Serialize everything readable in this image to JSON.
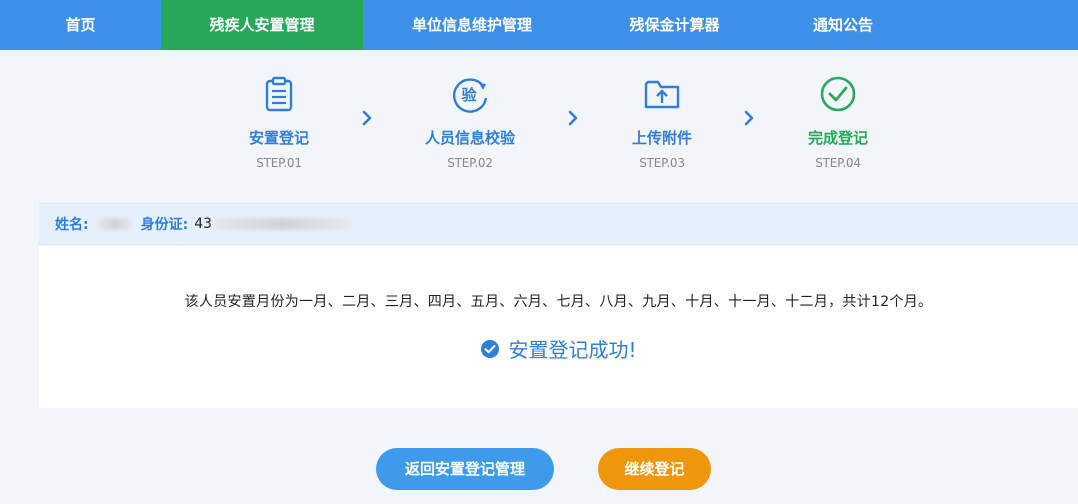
{
  "nav": {
    "items": [
      {
        "label": "首页",
        "active": false
      },
      {
        "label": "残疾人安置管理",
        "active": true
      },
      {
        "label": "单位信息维护管理",
        "active": false
      },
      {
        "label": "残保金计算器",
        "active": false
      },
      {
        "label": "通知公告",
        "active": false
      }
    ]
  },
  "steps": [
    {
      "title": "安置登记",
      "sub": "STEP.01",
      "icon": "clipboard-icon"
    },
    {
      "title": "人员信息校验",
      "sub": "STEP.02",
      "icon": "verify-icon",
      "glyph": "验"
    },
    {
      "title": "上传附件",
      "sub": "STEP.03",
      "icon": "upload-folder-icon"
    },
    {
      "title": "完成登记",
      "sub": "STEP.04",
      "icon": "check-circle-icon"
    }
  ],
  "info": {
    "name_label": "姓名:",
    "id_label": "身份证:",
    "id_value_visible": "43"
  },
  "result": {
    "months_text": "该人员安置月份为一月、二月、三月、四月、五月、六月、七月、八月、九月、十月、十一月、十二月，共计12个月。",
    "success_text": "安置登记成功!"
  },
  "buttons": {
    "back_label": "返回安置登记管理",
    "continue_label": "继续登记"
  },
  "colors": {
    "nav_bg": "#3d8fe8",
    "nav_active": "#27a85a",
    "accent_blue": "#2f7fd8",
    "done_green": "#27a85a",
    "continue_orange": "#f0960c"
  }
}
